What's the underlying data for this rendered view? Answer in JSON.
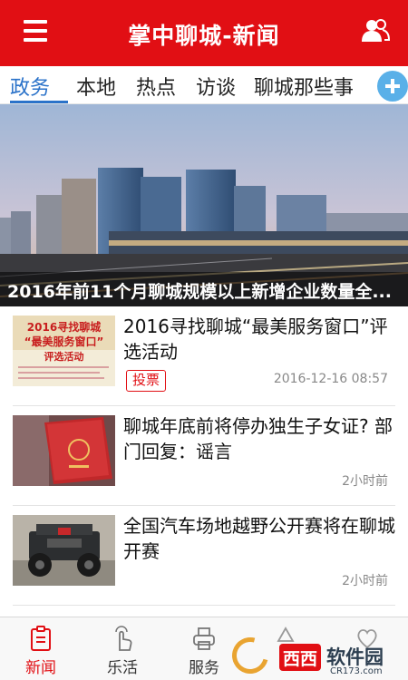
{
  "header": {
    "title": "掌中聊城-新闻",
    "menu_icon": "hamburger-menu-icon",
    "user_icon": "users-icon",
    "bg_color": "#e10f14"
  },
  "tabs": [
    {
      "label": "政务",
      "active": true
    },
    {
      "label": "本地",
      "active": false
    },
    {
      "label": "热点",
      "active": false
    },
    {
      "label": "访谈",
      "active": false
    },
    {
      "label": "聊城那些事",
      "active": false
    }
  ],
  "tab_accent_color": "#2a72c9",
  "banner": {
    "caption": "2016年前11个月聊城规模以上新增企业数量全..."
  },
  "news": [
    {
      "title": "2016寻找聊城“最美服务窗口”评选活动",
      "time": "2016-12-16 08:57",
      "badge": "投票",
      "thumb": {
        "line1": "2016寻找聊城",
        "line2": "“最美服务窗口”",
        "line3": "评选活动"
      }
    },
    {
      "title": "聊城年底前将停办独生子女证? 部门回复：谣言",
      "time": "2小时前"
    },
    {
      "title": "全国汽车场地越野公开赛将在聊城开赛",
      "time": "2小时前"
    }
  ],
  "bottom_nav": [
    {
      "label": "新闻",
      "icon": "news-icon",
      "active": true
    },
    {
      "label": "乐活",
      "icon": "hand-tap-icon",
      "active": false
    },
    {
      "label": "服务",
      "icon": "printer-icon",
      "active": false
    },
    {
      "label": "",
      "icon": "recycle-icon",
      "active": false
    },
    {
      "label": "",
      "icon": "heart-icon",
      "active": false
    }
  ],
  "watermark": {
    "brand": "西西",
    "text": "软件园",
    "sub": "CR173.com"
  }
}
